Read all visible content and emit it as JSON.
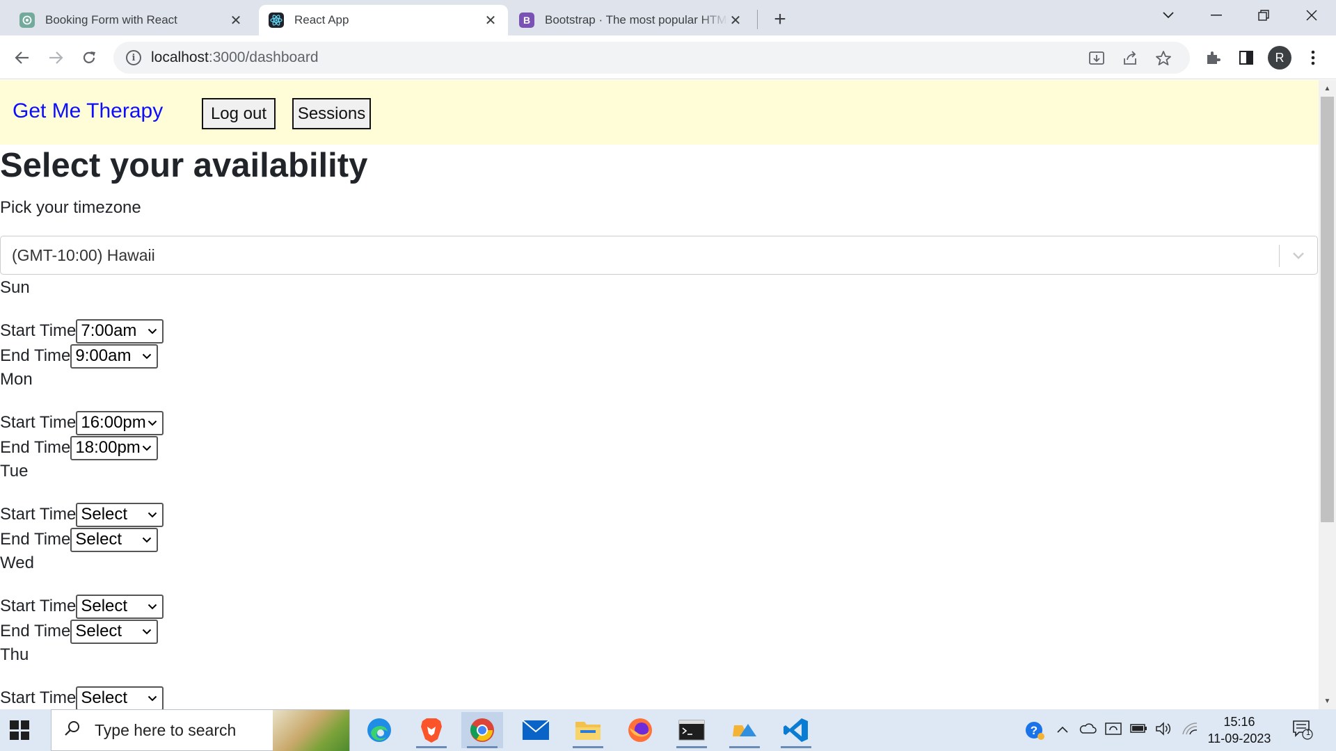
{
  "browser": {
    "tabs": [
      {
        "title": "Booking Form with React",
        "icon": "openai-icon"
      },
      {
        "title": "React App",
        "icon": "react-icon"
      },
      {
        "title": "Bootstrap · The most popular HTML",
        "icon": "bootstrap-icon"
      }
    ],
    "url_host": "localhost",
    "url_path": ":3000/dashboard",
    "profile_initial": "R"
  },
  "app": {
    "brand": "Get Me Therapy",
    "nav": {
      "logout_label": "Log out",
      "sessions_label": "Sessions"
    },
    "heading": "Select your availability",
    "timezone_label": "Pick your timezone",
    "timezone_value": "(GMT-10:00) Hawaii",
    "start_label": "Start Time",
    "end_label": "End Time",
    "days": [
      {
        "name": "Sun",
        "start": "7:00am",
        "end": "9:00am"
      },
      {
        "name": "Mon",
        "start": "16:00pm",
        "end": "18:00pm"
      },
      {
        "name": "Tue",
        "start": "Select",
        "end": "Select"
      },
      {
        "name": "Wed",
        "start": "Select",
        "end": "Select"
      },
      {
        "name": "Thu",
        "start": "Select",
        "end": null
      }
    ]
  },
  "taskbar": {
    "search_placeholder": "Type here to search",
    "time": "15:16",
    "date": "11-09-2023",
    "notification_count": "1"
  },
  "colors": {
    "navbar_bg": "#fffdd8",
    "brand": "#0d0dff",
    "tab_strip": "#dfe3eb",
    "taskbar": "#dde8f4"
  }
}
